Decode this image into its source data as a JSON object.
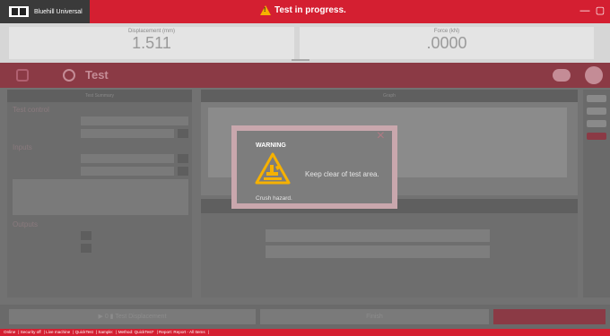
{
  "window": {
    "app_name": "Bluehill Universal",
    "status": "Test in progress.",
    "minimize_label": "—",
    "maximize_label": "▢"
  },
  "meters": [
    {
      "label": "Displacement (mm)",
      "value": "1.511"
    },
    {
      "label": "Force (kN)",
      "value": ".0000"
    }
  ],
  "toolbar": {
    "title": "Test"
  },
  "left_panel": {
    "header": "Test Summary",
    "sections": {
      "test_control": "Test control",
      "inputs": "Inputs",
      "outputs": "Outputs"
    }
  },
  "graph_panel": {
    "header": "Graph"
  },
  "bottom": {
    "start_label": "▶ 0 ▮ Test Displacement",
    "finish_label": "Finish"
  },
  "dialog": {
    "title": "WARNING",
    "message": "Keep clear of test area.",
    "caption": "Crush hazard.",
    "close_label": "×",
    "hazard_color": "#f6b100"
  },
  "statusbar": {
    "items": [
      "Online",
      "Security off",
      "Live machine",
      "QuickTest",
      "Sample:",
      "Method: QuickTest*",
      "Report: Report - All Items"
    ]
  },
  "colors": {
    "accent": "#d41f31"
  }
}
